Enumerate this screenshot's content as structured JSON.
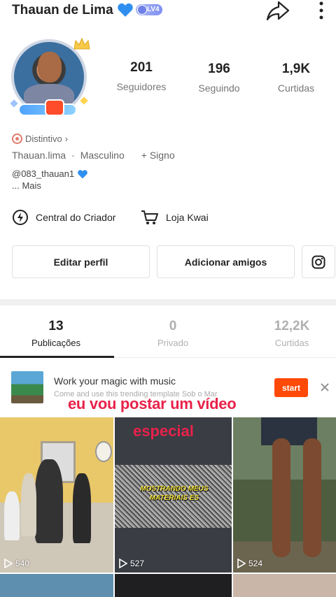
{
  "header": {
    "username": "Thauan de Lima",
    "level": "LV4",
    "icons": {
      "heart": "blue-heart-icon",
      "share": "share-arrow-icon",
      "more": "more-vertical-icon"
    }
  },
  "stats": [
    {
      "value": "201",
      "label": "Seguidores"
    },
    {
      "value": "196",
      "label": "Seguindo"
    },
    {
      "value": "1,9K",
      "label": "Curtidas"
    }
  ],
  "profile": {
    "badge_label": "Distintivo",
    "handle_name": "Thauan.lima",
    "gender": "Masculino",
    "sign_label": "+ Signo",
    "bio_handle": "@083_thauan1",
    "more_label": "... Mais"
  },
  "links": {
    "creator_center": "Central do Criador",
    "shop": "Loja Kwai"
  },
  "buttons": {
    "edit_profile": "Editar perfil",
    "add_friends": "Adicionar amigos"
  },
  "tabs": [
    {
      "count": "13",
      "label": "Publicações",
      "active": true
    },
    {
      "count": "0",
      "label": "Privado",
      "active": false
    },
    {
      "count": "12,2K",
      "label": "Curtidas",
      "active": false
    }
  ],
  "banner": {
    "title": "Work your magic with music",
    "subtitle": "Come and use this trending template Sob o Mar",
    "start_label": "start"
  },
  "overlay_text": {
    "line1": "eu vou postar um vídeo",
    "line2": "especial"
  },
  "grid": [
    {
      "views": "540"
    },
    {
      "views": "527",
      "caption": "MOSTRANDO MEUS MATERIAIS ES"
    },
    {
      "views": "524"
    }
  ],
  "colors": {
    "accent": "#ff4906",
    "overlay_red": "#e8224a",
    "text_primary": "#222222",
    "text_secondary": "#777777"
  }
}
